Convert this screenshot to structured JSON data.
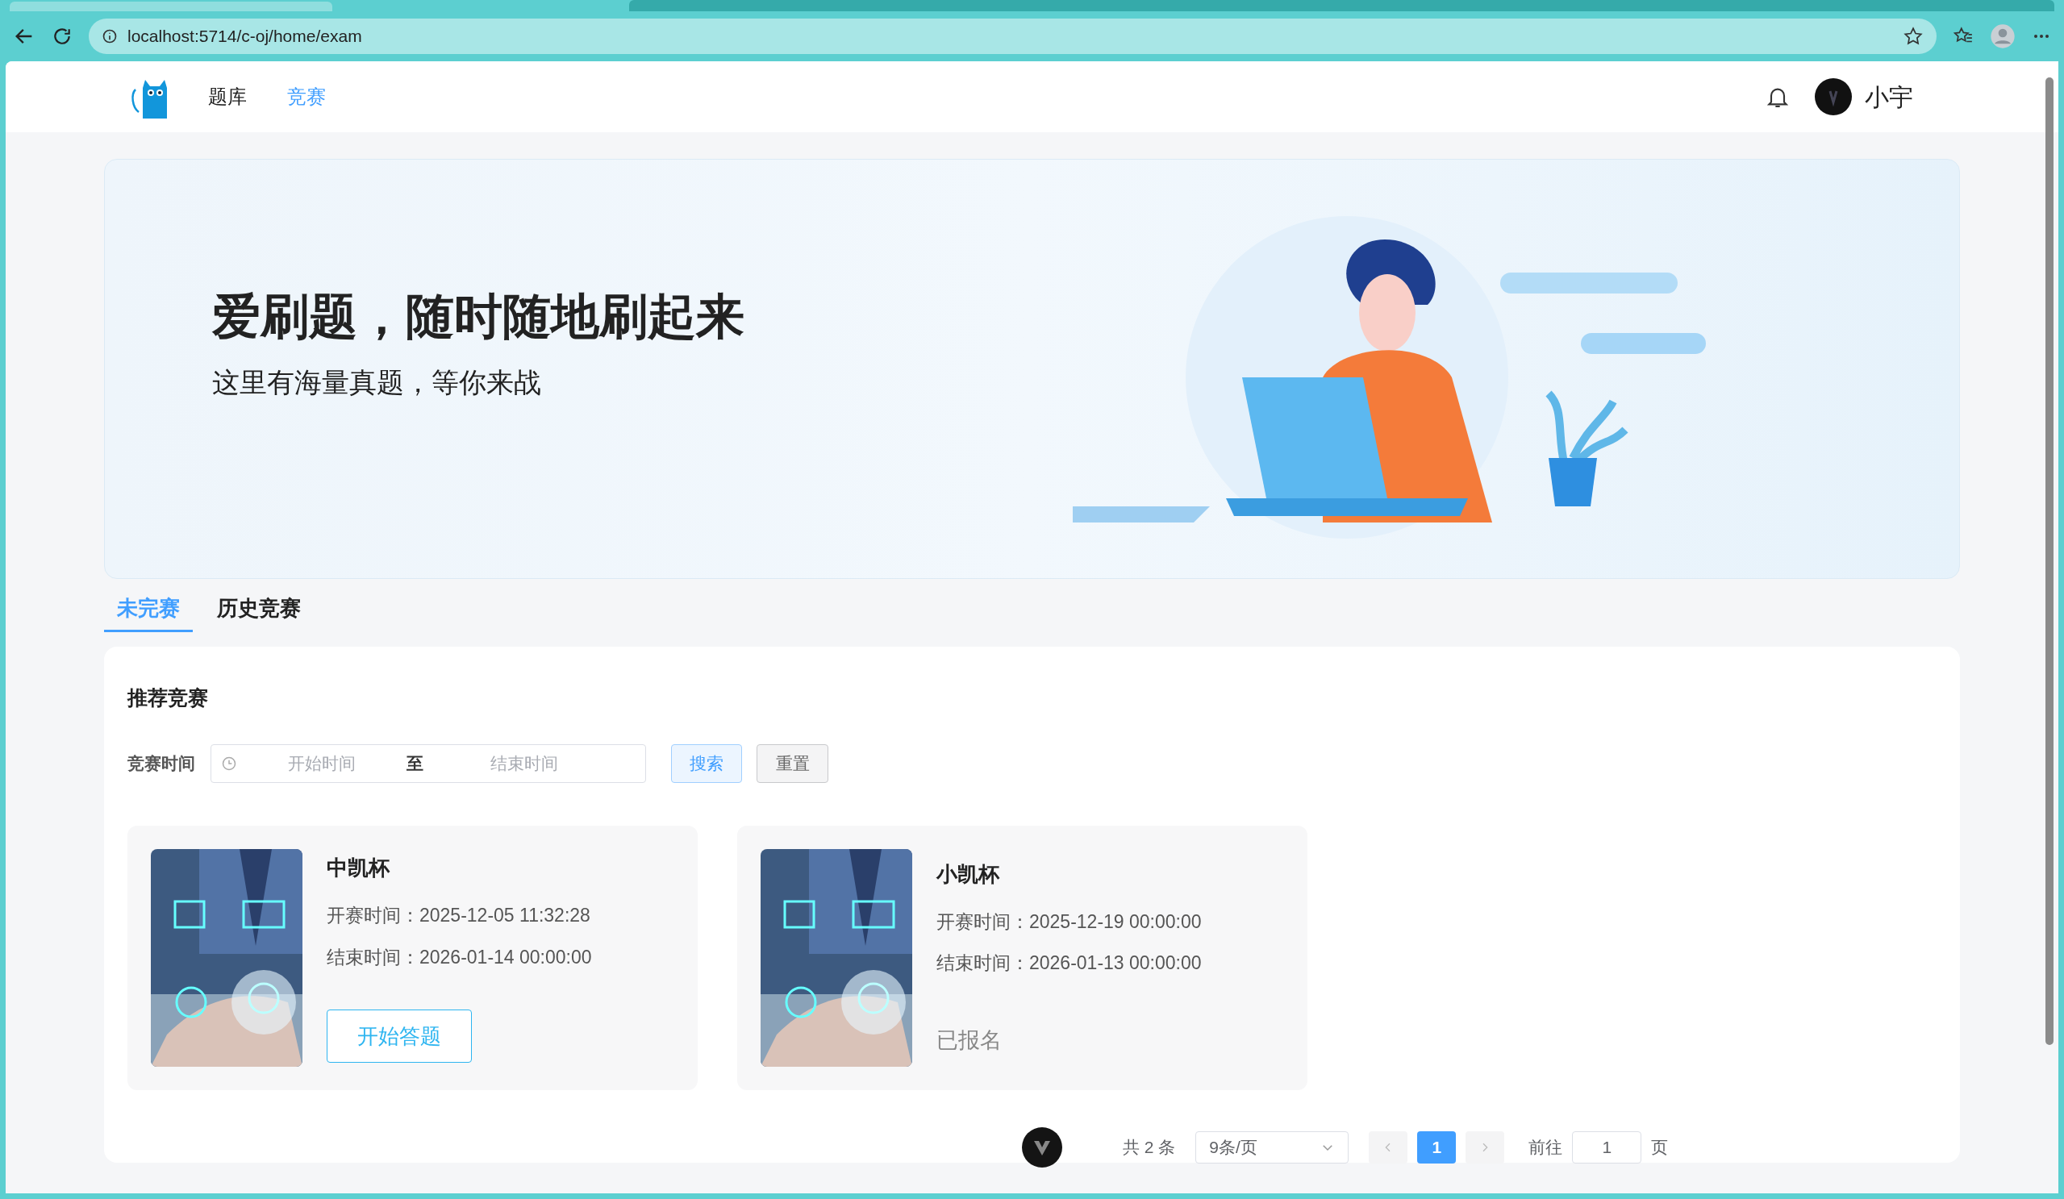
{
  "browser": {
    "url": "localhost:5714/c-oj/home/exam"
  },
  "nav": {
    "items": [
      {
        "label": "题库",
        "selected": false
      },
      {
        "label": "竞赛",
        "selected": true
      }
    ],
    "user": {
      "name": "小宇"
    }
  },
  "banner": {
    "title": "爱刷题，随时随地刷起来",
    "subtitle": "这里有海量真题，等你来战"
  },
  "tabs": [
    {
      "label": "未完赛",
      "selected": true
    },
    {
      "label": "历史竞赛",
      "selected": false
    }
  ],
  "section": {
    "title": "推荐竞赛",
    "filter": {
      "label": "竞赛时间",
      "start_placeholder": "开始时间",
      "separator": "至",
      "end_placeholder": "结束时间",
      "buttons": [
        {
          "label": "搜索",
          "kind": "primary"
        },
        {
          "label": "重置",
          "kind": "default"
        }
      ]
    },
    "contests": [
      {
        "title": "中凯杯",
        "start": "开赛时间：2025-12-05 11:32:28",
        "end": "结束时间：2026-01-14 00:00:00",
        "action": {
          "kind": "button",
          "label": "开始答题"
        }
      },
      {
        "title": "小凯杯",
        "start": "开赛时间：2025-12-19 00:00:00",
        "end": "结束时间：2026-01-13 00:00:00",
        "action": {
          "kind": "status",
          "label": "已报名"
        }
      }
    ]
  },
  "pagination": {
    "total": "共 2 条",
    "page_size": "9条/页",
    "pages": [
      {
        "label": "1",
        "selected": true
      }
    ],
    "goto_label": "前往",
    "goto_value": "1",
    "goto_suffix": "页"
  }
}
